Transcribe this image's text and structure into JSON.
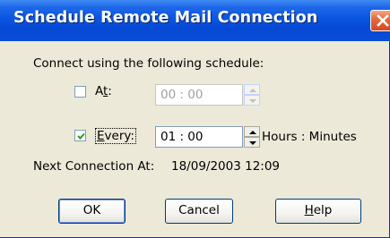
{
  "window": {
    "title": "Schedule Remote Mail Connection",
    "close_icon": "close-icon"
  },
  "schedule": {
    "prompt": "Connect using the following schedule:",
    "at": {
      "label_pre": "A",
      "label_mnemonic": "t",
      "label_post": ":",
      "checked": false,
      "value": "00 : 00",
      "enabled": false
    },
    "every": {
      "label_mnemonic": "E",
      "label_post": "very:",
      "checked": true,
      "value": "01 : 00",
      "units": "Hours : Minutes",
      "enabled": true
    },
    "next_connection_label": "Next Connection At:",
    "next_connection_value": "18/09/2003 12:09"
  },
  "buttons": {
    "ok": "OK",
    "cancel": "Cancel",
    "help_mnemonic": "H",
    "help_rest": "elp"
  },
  "colors": {
    "titlebar": "#0a55e0",
    "dialog_bg": "#ece9d8",
    "close_button": "#e66b42"
  }
}
